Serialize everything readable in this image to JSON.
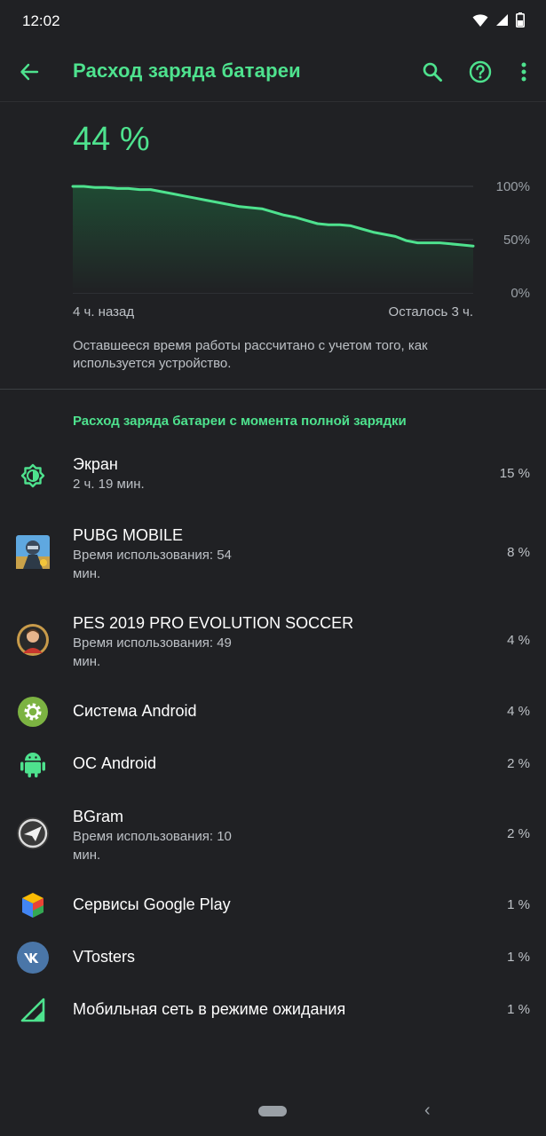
{
  "status_bar": {
    "time": "12:02",
    "icons": [
      "wifi-icon",
      "cell-signal-icon",
      "battery-icon"
    ]
  },
  "app_bar": {
    "title": "Расход заряда батареи",
    "icons": [
      "back-arrow-icon",
      "search-icon",
      "help-icon",
      "more-vert-icon"
    ]
  },
  "battery": {
    "percent_label": "44 %",
    "note": "Оставшееся время работы рассчитано с учетом того, как используется устройство."
  },
  "chart_data": {
    "type": "area",
    "y_ticks": [
      "100%",
      "50%",
      "0%"
    ],
    "ylim": [
      0,
      100
    ],
    "x_start_label": "4 ч. назад",
    "x_end_label": "Осталось 3 ч.",
    "values": [
      100,
      100,
      99,
      99,
      98,
      98,
      97,
      97,
      95,
      93,
      91,
      89,
      87,
      85,
      83,
      81,
      80,
      79,
      76,
      73,
      71,
      68,
      65,
      64,
      64,
      63,
      60,
      57,
      55,
      53,
      49,
      47,
      47,
      47,
      46,
      45,
      44
    ],
    "colors": {
      "line": "#4ee28e",
      "fill_top": "#1f4a33",
      "grid": "#3c4043"
    }
  },
  "usage": {
    "header": "Расход заряда батареи с момента полной зарядки",
    "items": [
      {
        "icon": "screen-brightness-icon",
        "title": "Экран",
        "subtitle": "2 ч. 19 мин.",
        "percent": "15 %"
      },
      {
        "icon": "pubg-app-icon",
        "title": "PUBG MOBILE",
        "subtitle": "Время использования: 54 мин.",
        "percent": "8 %"
      },
      {
        "icon": "pes-app-icon",
        "title": "PES 2019 PRO EVOLUTION SOCCER",
        "subtitle": "Время использования: 49 мин.",
        "percent": "4 %"
      },
      {
        "icon": "android-settings-icon",
        "title": "Система Android",
        "subtitle": "",
        "percent": "4 %"
      },
      {
        "icon": "android-robot-icon",
        "title": "ОС Android",
        "subtitle": "",
        "percent": "2 %"
      },
      {
        "icon": "bgram-app-icon",
        "title": "BGram",
        "subtitle": "Время использования: 10 мин.",
        "percent": "2 %"
      },
      {
        "icon": "google-play-services-icon",
        "title": "Сервисы Google Play",
        "subtitle": "",
        "percent": "1 %"
      },
      {
        "icon": "vk-app-icon",
        "title": "VTosters",
        "subtitle": "",
        "percent": "1 %"
      },
      {
        "icon": "cell-standby-icon",
        "title": "Мобильная сеть в режиме ожидания",
        "subtitle": "",
        "percent": "1 %"
      }
    ]
  },
  "nav_bar": {
    "icons": [
      "home-pill-icon",
      "nav-back-icon"
    ],
    "back_glyph": "‹"
  }
}
